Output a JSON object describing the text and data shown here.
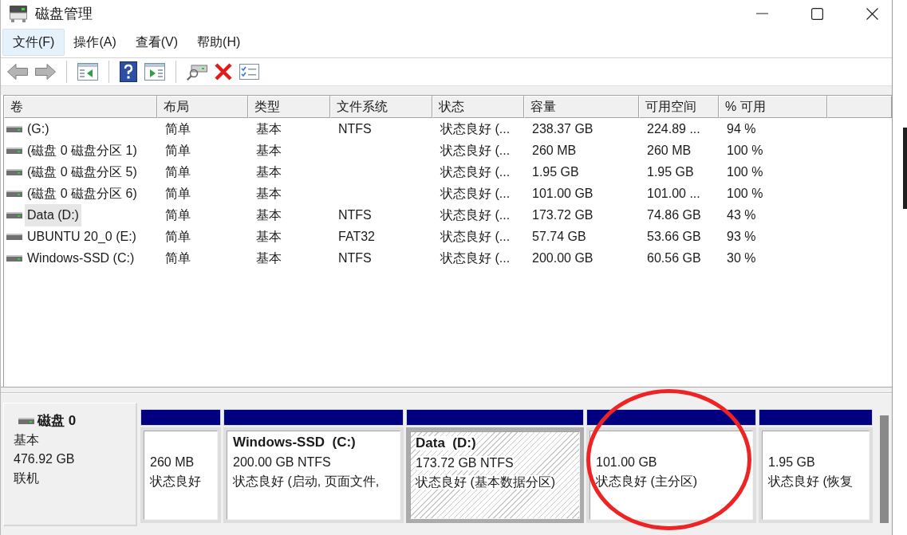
{
  "window": {
    "title": "磁盘管理"
  },
  "menu": [
    {
      "label": "文件(F)",
      "selected": true
    },
    {
      "label": "操作(A)",
      "selected": false
    },
    {
      "label": "查看(V)",
      "selected": false
    },
    {
      "label": "帮助(H)",
      "selected": false
    }
  ],
  "table": {
    "columns": [
      "卷",
      "布局",
      "类型",
      "文件系统",
      "状态",
      "容量",
      "可用空间",
      "% 可用"
    ],
    "rows": [
      {
        "volume": "(G:)",
        "layout": "简单",
        "type": "基本",
        "file_system": "NTFS",
        "status": "状态良好 (...",
        "capacity": "238.37 GB",
        "free_space": "224.89 ...",
        "percent_free": "94 %",
        "status_light": true,
        "selected": false
      },
      {
        "volume": "(磁盘 0 磁盘分区 1)",
        "layout": "简单",
        "type": "基本",
        "status": "状态良好 (...",
        "capacity": "260 MB",
        "free_space": "260 MB",
        "percent_free": "100 %",
        "status_light": true,
        "selected": false
      },
      {
        "volume": "(磁盘 0 磁盘分区 5)",
        "layout": "简单",
        "type": "基本",
        "status": "状态良好 (...",
        "capacity": "1.95 GB",
        "free_space": "1.95 GB",
        "percent_free": "100 %",
        "status_light": true,
        "selected": false
      },
      {
        "volume": "(磁盘 0 磁盘分区 6)",
        "layout": "简单",
        "type": "基本",
        "status": "状态良好 (...",
        "capacity": "101.00 GB",
        "free_space": "101.00 ...",
        "percent_free": "100 %",
        "status_light": true,
        "selected": false
      },
      {
        "volume": "Data (D:)",
        "layout": "简单",
        "type": "基本",
        "file_system": "NTFS",
        "status": "状态良好 (...",
        "capacity": "173.72 GB",
        "free_space": "74.86 GB",
        "percent_free": "43 %",
        "status_light": true,
        "selected": true
      },
      {
        "volume": "UBUNTU 20_0 (E:)",
        "layout": "简单",
        "type": "基本",
        "file_system": "FAT32",
        "status": "状态良好 (...",
        "capacity": "57.74 GB",
        "free_space": "53.66 GB",
        "percent_free": "93 %",
        "status_light": false,
        "selected": false
      },
      {
        "volume": "Windows-SSD (C:)",
        "layout": "简单",
        "type": "基本",
        "file_system": "NTFS",
        "status": "状态良好 (...",
        "capacity": "200.00 GB",
        "free_space": "60.56 GB",
        "percent_free": "30 %",
        "status_light": true,
        "selected": false
      }
    ]
  },
  "disk": {
    "name": "磁盘 0",
    "type": "基本",
    "size": "476.92 GB",
    "status": "联机",
    "partitions": [
      {
        "details": "260 MB",
        "status": "状态良好",
        "selected": false,
        "circled": false
      },
      {
        "name": "Windows-SSD  (C:)",
        "details": "200.00 GB NTFS",
        "status": "状态良好 (启动, 页面文件,",
        "selected": false,
        "circled": false
      },
      {
        "name": "Data  (D:)",
        "details": "173.72 GB NTFS",
        "status": "状态良好 (基本数据分区)",
        "selected": true,
        "circled": false
      },
      {
        "details": "101.00 GB",
        "status": "状态良好 (主分区)",
        "selected": false,
        "circled": true
      },
      {
        "details": "1.95 GB",
        "status": "状态良好 (恢复",
        "selected": false,
        "circled": false
      }
    ]
  }
}
